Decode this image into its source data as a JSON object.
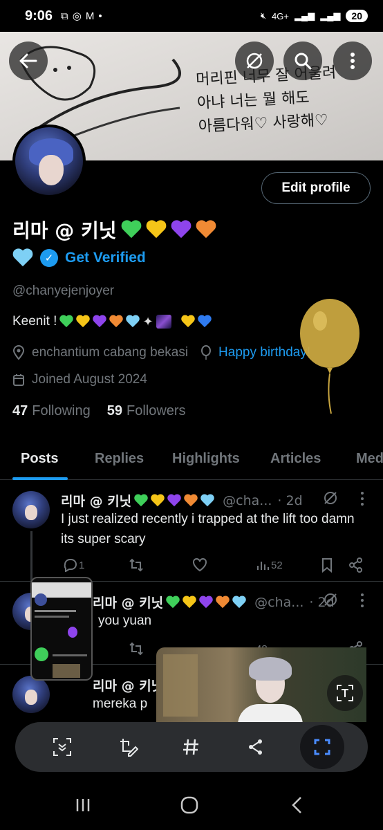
{
  "status": {
    "time": "9:06",
    "network": "4G+",
    "battery": "20"
  },
  "banner": {
    "lines": [
      "머리핀 너무 잘 어울려",
      "아냐 너는 뭘 해도",
      "아름다워♡ 사랑해♡"
    ]
  },
  "profile": {
    "display_name": "리마 @ 키닛",
    "get_verified": "Get Verified",
    "handle": "@chanyejenjoyer",
    "bio": "Keenit !",
    "location": "enchantium cabang bekasi",
    "birthday_link": "Happy birthday!",
    "joined": "Joined August 2024",
    "following_count": "47",
    "following_label": "Following",
    "followers_count": "59",
    "followers_label": "Followers",
    "edit_profile": "Edit profile"
  },
  "tabs": [
    "Posts",
    "Replies",
    "Highlights",
    "Articles",
    "Media"
  ],
  "active_tab": "Posts",
  "posts": [
    {
      "name": "리마 @ 키닛",
      "handle": "@cha...",
      "time": "· 2d",
      "text": "I just realized recently i trapped at the lift too damn its super scary",
      "replies": "1",
      "views": "52"
    },
    {
      "name": "리마 @ 키닛",
      "handle": "@cha...",
      "time": "· 2d",
      "text": "you yuan",
      "views": "48"
    },
    {
      "name": "리마 @ 키닛",
      "text": "mereka p"
    }
  ],
  "colors": {
    "accent": "#1d9bf0",
    "muted": "#71767b",
    "heart_green": "#3fcf5a",
    "heart_yellow": "#f5c518",
    "heart_purple": "#8e44ec",
    "heart_orange": "#f08a34",
    "heart_lightblue": "#7ed0f5",
    "heart_blue": "#2f7bf0",
    "balloon": "#c9a640"
  },
  "icons": [
    "back-arrow-icon",
    "no-signal-icon",
    "search-icon",
    "more-icon",
    "verified-icon",
    "location-icon",
    "balloon-icon",
    "calendar-icon",
    "reply-icon",
    "retweet-icon",
    "like-icon",
    "views-icon",
    "bookmark-icon",
    "share-icon"
  ]
}
